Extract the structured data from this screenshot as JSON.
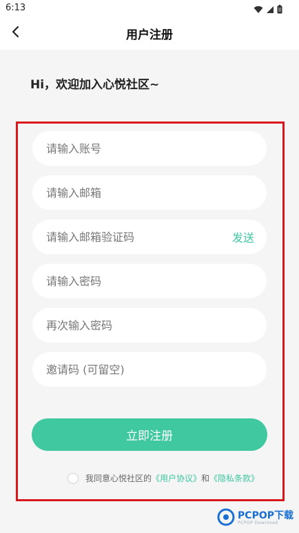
{
  "status_bar": {
    "time": "6:13",
    "icons": [
      "wifi-icon",
      "cell-signal-icon",
      "battery-icon"
    ]
  },
  "header": {
    "title": "用户注册",
    "back_icon": "chevron-left-icon"
  },
  "greeting": "Hi，欢迎加入心悦社区~",
  "form": {
    "fields": [
      {
        "placeholder": "请输入账号",
        "value": ""
      },
      {
        "placeholder": "请输入邮箱",
        "value": ""
      },
      {
        "placeholder": "请输入邮箱验证码",
        "value": ""
      },
      {
        "placeholder": "请输入密码",
        "value": ""
      },
      {
        "placeholder": "再次输入密码",
        "value": ""
      },
      {
        "placeholder": "邀请码 (可留空)",
        "value": ""
      }
    ],
    "send_label": "发送",
    "submit_label": "立即注册"
  },
  "agreement": {
    "prefix": "我同意心悦社区的",
    "user_agreement": "《用户协议》",
    "and": "和",
    "privacy_policy": "《隐私条款》",
    "checked": false
  },
  "watermark": {
    "text": "PCPOP下载",
    "sub": "PCPOP Download"
  },
  "colors": {
    "accent": "#40c8a1",
    "highlight_border": "#d8161c",
    "background": "#f5f5f5"
  }
}
